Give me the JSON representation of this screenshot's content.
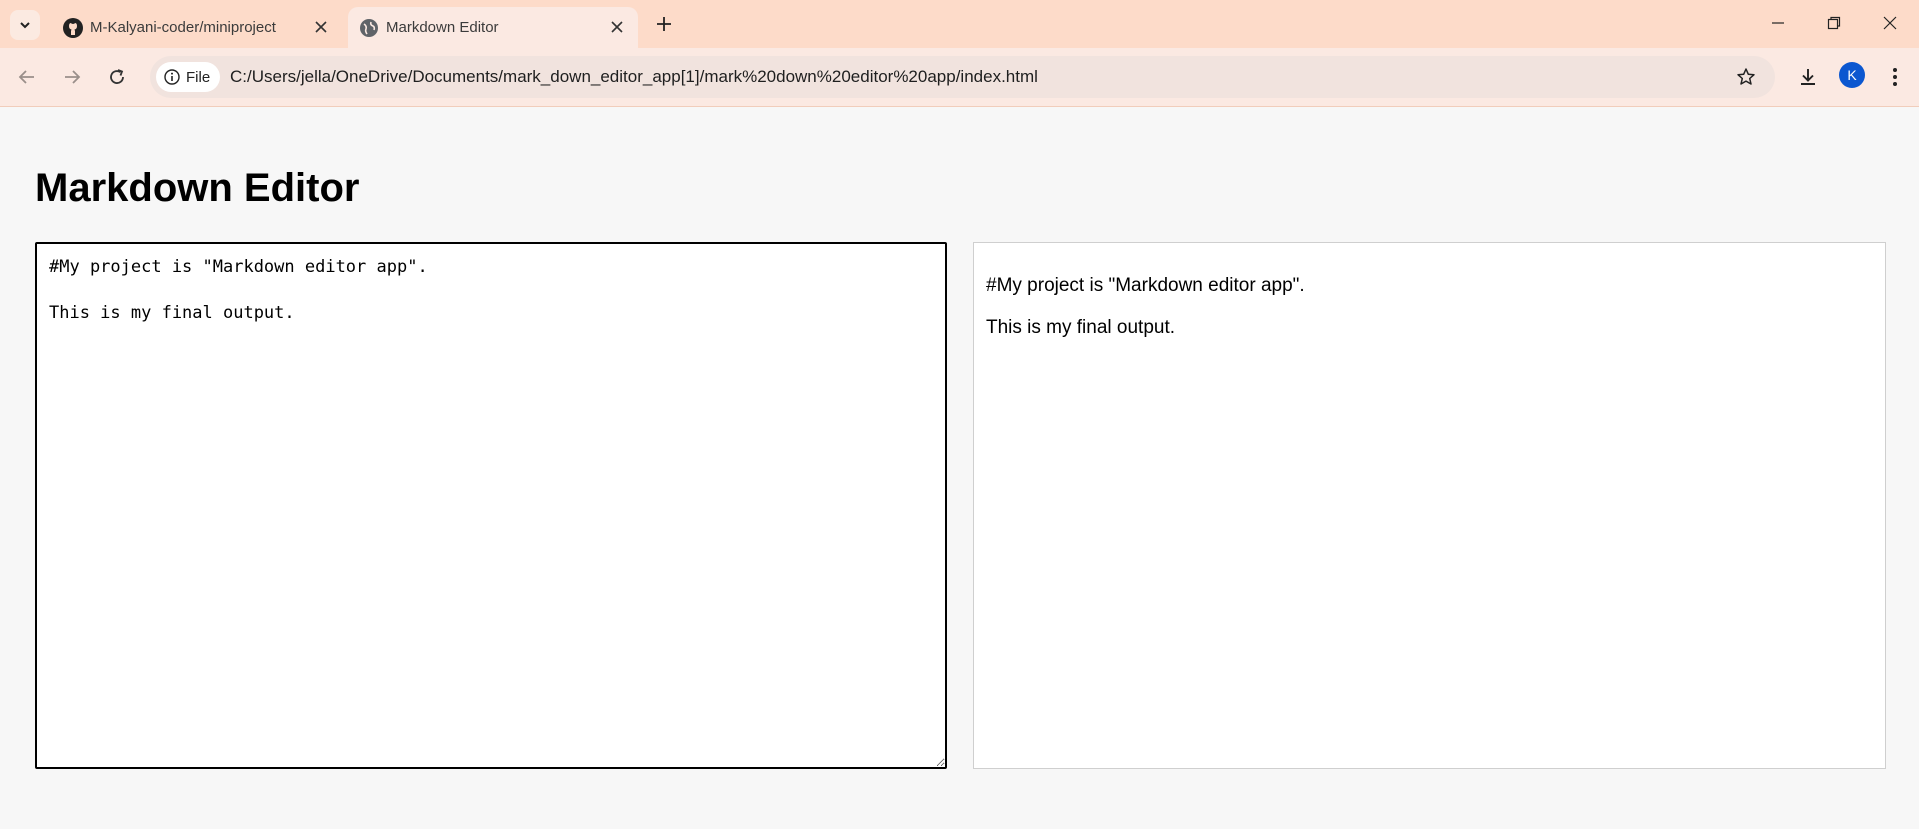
{
  "browser": {
    "tabs": [
      {
        "title": "M-Kalyani-coder/miniproject",
        "icon": "github-icon",
        "active": false
      },
      {
        "title": "Markdown Editor",
        "icon": "globe-icon",
        "active": true
      }
    ],
    "address_chip": "File",
    "url": "C:/Users/jella/OneDrive/Documents/mark_down_editor_app[1]/mark%20down%20editor%20app/index.html",
    "profile_initial": "K",
    "colors": {
      "tabbar": "#fddbc9",
      "toolbar": "#fbe9e2",
      "avatar": "#0b57d0"
    }
  },
  "page": {
    "title": "Markdown Editor",
    "editor_value": "#My project is \"Markdown editor app\".\n\nThis is my final output.\n\n",
    "preview": [
      "#My project is \"Markdown editor app\".",
      "This is my final output."
    ]
  }
}
